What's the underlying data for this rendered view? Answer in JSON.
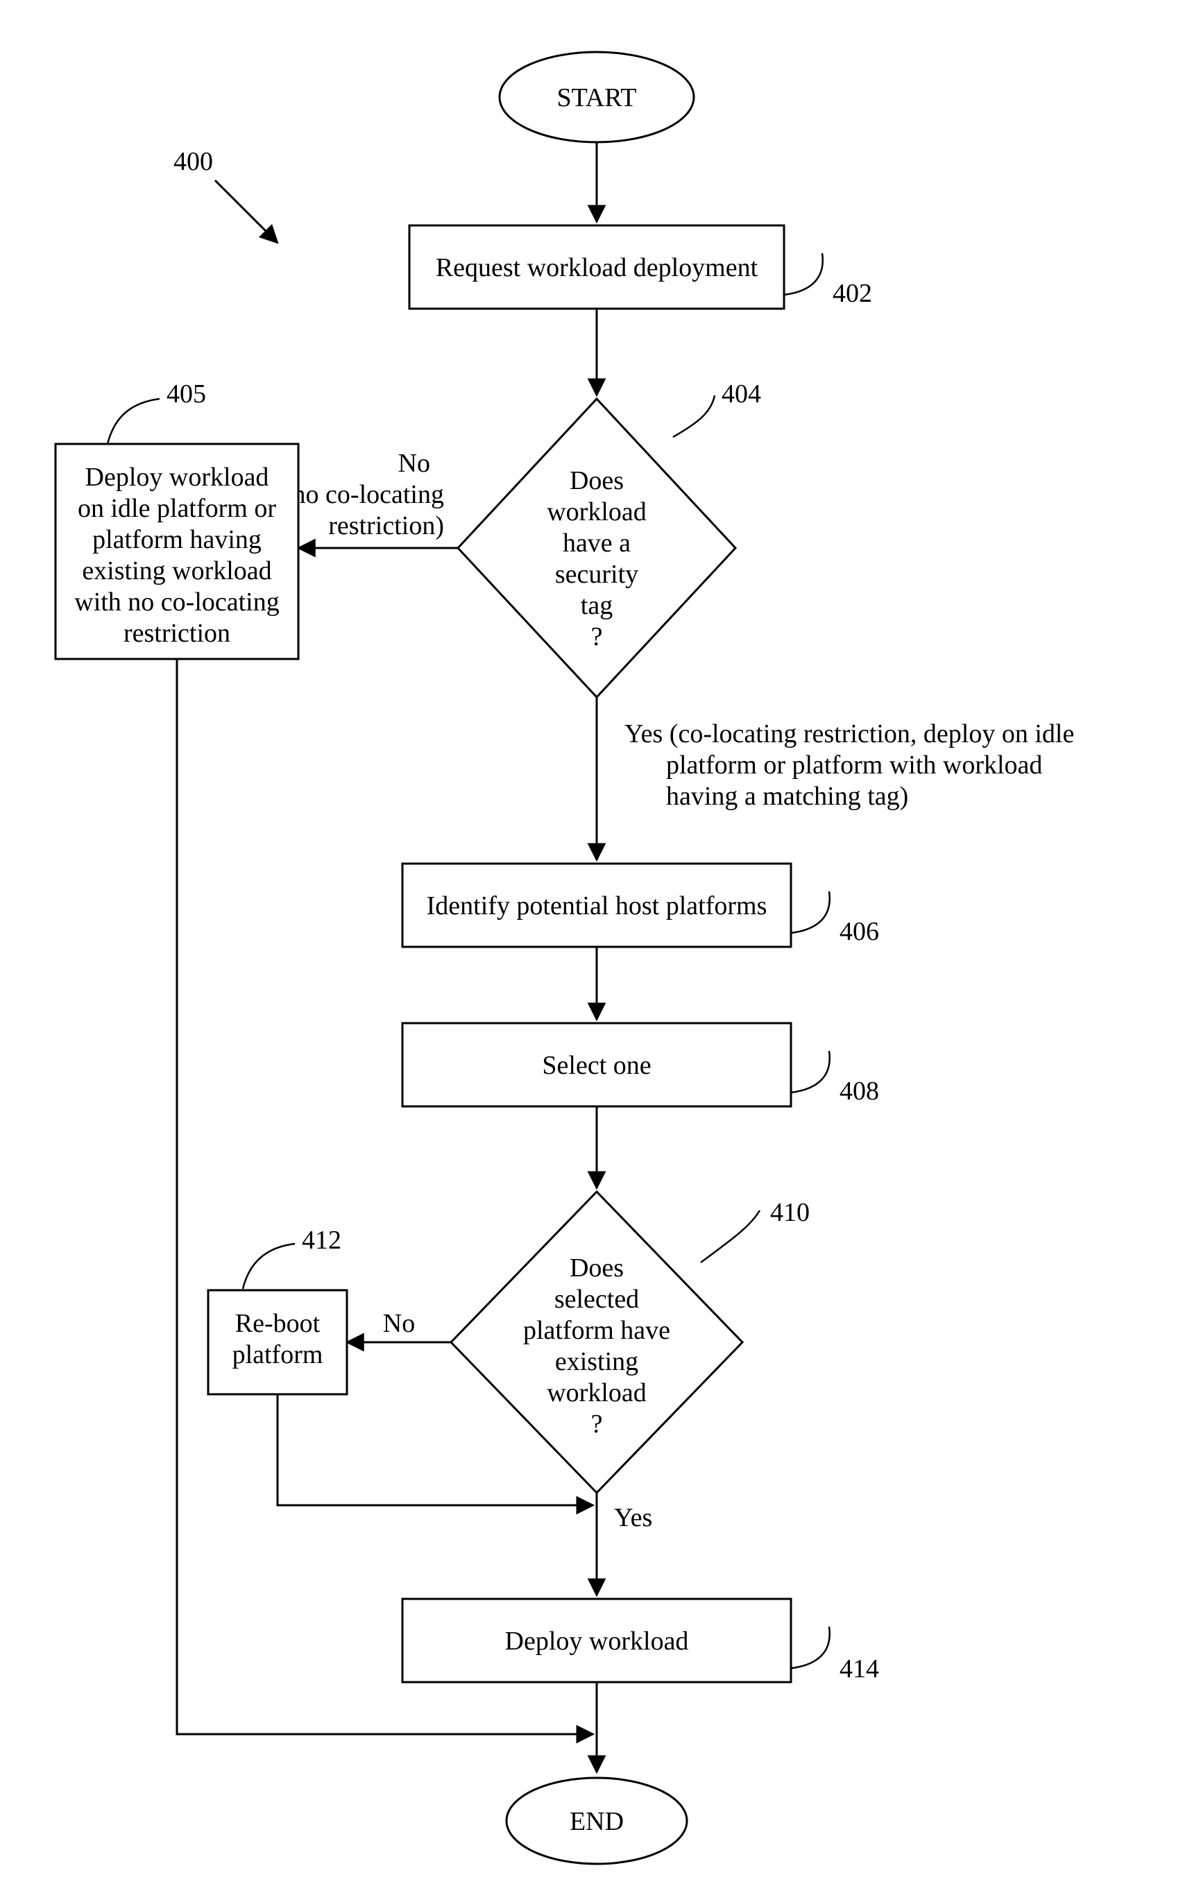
{
  "figure_ref": "400",
  "nodes": {
    "start": {
      "label": "START"
    },
    "n402": {
      "ref": "402",
      "text": "Request workload deployment"
    },
    "n404": {
      "ref": "404",
      "line1": "Does",
      "line2": "workload",
      "line3": "have a",
      "line4": "security",
      "line5": "tag",
      "line6": "?"
    },
    "n405": {
      "ref": "405",
      "line1": "Deploy workload",
      "line2": "on idle platform or",
      "line3": "platform having",
      "line4": "existing workload",
      "line5": "with no co-locating",
      "line6": "restriction"
    },
    "n406": {
      "ref": "406",
      "text": "Identify potential host platforms"
    },
    "n408": {
      "ref": "408",
      "text": "Select one"
    },
    "n410": {
      "ref": "410",
      "line1": "Does",
      "line2": "selected",
      "line3": "platform have",
      "line4": "existing",
      "line5": "workload",
      "line6": "?"
    },
    "n412": {
      "ref": "412",
      "line1": "Re-boot",
      "line2": "platform"
    },
    "n414": {
      "ref": "414",
      "text": "Deploy workload"
    },
    "end": {
      "label": "END"
    }
  },
  "edges": {
    "e404_no": {
      "line1": "No",
      "line2": "(no co-locating",
      "line3": "restriction)"
    },
    "e404_yes": {
      "line1": "Yes (co-locating restriction, deploy on idle",
      "line2": "platform or platform with workload",
      "line3": "having a matching tag)"
    },
    "e410_no": "No",
    "e410_yes": "Yes"
  }
}
